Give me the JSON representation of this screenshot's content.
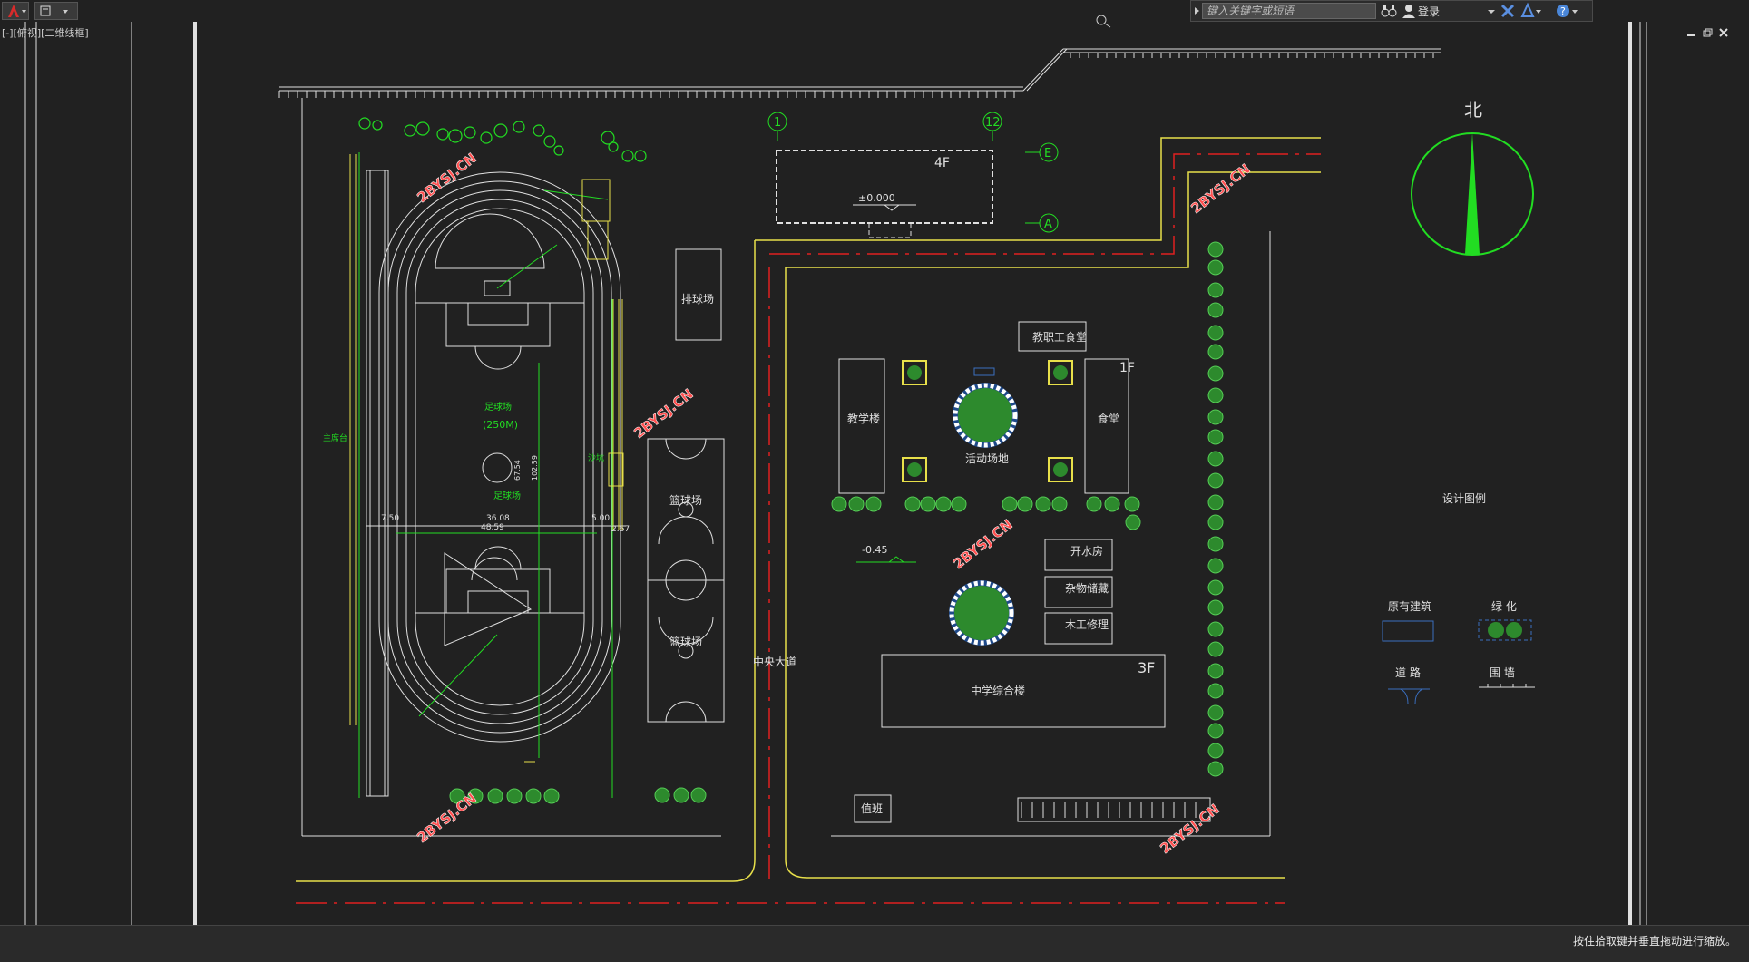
{
  "app": {
    "search_placeholder": "键入关键字或短语",
    "login_label": "登录",
    "viewport_label": "[-][俯视][二维线框]"
  },
  "status": {
    "message": "按住拾取键并垂直拖动进行缩放。"
  },
  "drawing": {
    "north_label": "北",
    "axis_labels": [
      "1",
      "12",
      "E",
      "A"
    ],
    "floors": {
      "top": "4F",
      "canteen": "1F",
      "complex": "3F"
    },
    "elevations": {
      "top_building": "±0.000",
      "ground": "-0.45"
    },
    "watermark": "2BYSJ.CN",
    "buildings": {
      "volleyball": "排球场",
      "staff_canteen": "教职工食堂",
      "teaching": "教学楼",
      "canteen": "食堂",
      "activity": "活动场地",
      "water_room": "开水房",
      "storage": "杂物储藏",
      "carpentry": "木工修理",
      "complex": "中学综合楼",
      "guard": "值班",
      "basketball_1": "篮球场",
      "basketball_2": "篮球场",
      "main_road": "中央大道"
    },
    "track": {
      "field_top": "足球场",
      "field_size": "(250M)",
      "field_bottom": "足球场",
      "dim_1": "36.08",
      "dim_2": "48.59",
      "dim_3": "7.50",
      "dim_4": "5.00",
      "dim_5": "67.54",
      "dim_6": "102.59",
      "dim_7": "2.67",
      "tag_left": "主席台",
      "tag_right": "沙坑"
    },
    "legend": {
      "title": "设计图例",
      "existing": "原有建筑",
      "green": "绿 化",
      "road": "道 路",
      "wall": "围 墙"
    }
  },
  "colors": {
    "background": "#212121",
    "line_white": "#e0e0e0",
    "line_yellow": "#e8e04a",
    "line_red": "#e02020",
    "line_green": "#22dd22",
    "watermark": "#ff5050"
  }
}
